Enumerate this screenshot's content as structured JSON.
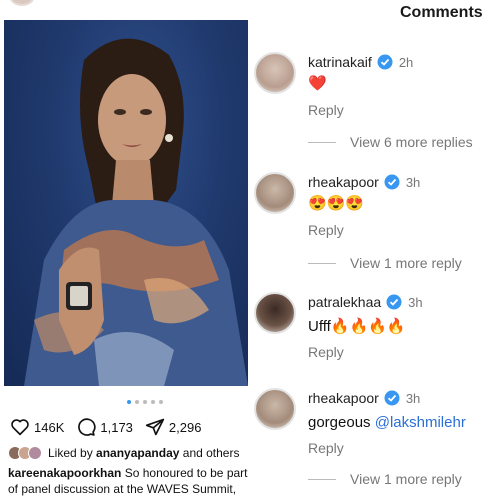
{
  "post": {
    "action_counts": {
      "likes": "146K",
      "comments": "1,173",
      "shares": "2,296"
    },
    "liked_by": {
      "prefix": "Liked by",
      "user": "ananyapanday",
      "suffix": "and others"
    },
    "caption": {
      "user": "kareenakapoorkhan",
      "text": "So honoured to be part of panel discussion at the WAVES Summit, wher..."
    },
    "carousel": {
      "count": 5,
      "active_index": 0
    }
  },
  "comments": {
    "title": "Comments",
    "items": [
      {
        "user": "katrinakaif",
        "time": "2h",
        "text": "❤️",
        "reply": "Reply",
        "more_replies": "View 6 more replies"
      },
      {
        "user": "rheakapoor",
        "time": "3h",
        "text": "😍😍😍",
        "reply": "Reply",
        "more_replies": "View 1 more reply"
      },
      {
        "user": "patralekhaa",
        "time": "3h",
        "text": "Ufff🔥🔥🔥🔥",
        "reply": "Reply",
        "more_replies": ""
      },
      {
        "user": "rheakapoor",
        "time": "3h",
        "text": "gorgeous",
        "mention": "@lakshmilehr",
        "reply": "Reply",
        "more_replies": "View 1 more reply"
      }
    ]
  },
  "colors": {
    "verified": "#3897f0",
    "mention": "#2a6fd6",
    "muted": "#777777",
    "photo_bg": "#1f3a6e"
  },
  "icons": [
    "heart-icon",
    "comment-icon",
    "share-icon",
    "verified-badge-icon"
  ]
}
